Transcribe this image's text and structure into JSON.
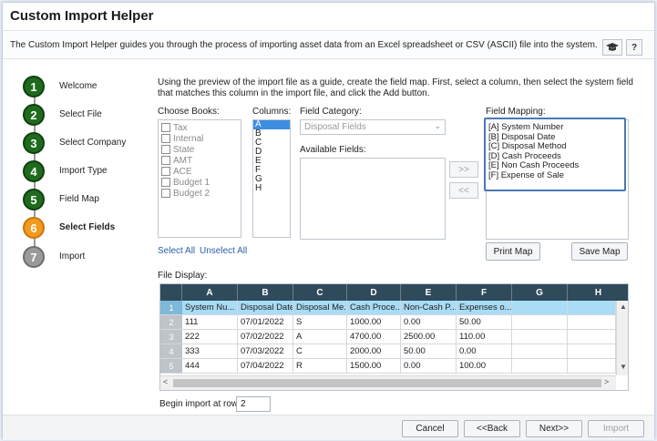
{
  "window": {
    "title": "Custom Import Helper",
    "subtitle": "The Custom Import Helper guides you through the process of importing asset data from an Excel spreadsheet or CSV (ASCII) file into the system.",
    "help_label": "?"
  },
  "steps": [
    {
      "num": "1",
      "label": "Welcome",
      "state": "done"
    },
    {
      "num": "2",
      "label": "Select File",
      "state": "done"
    },
    {
      "num": "3",
      "label": "Select Company",
      "state": "done"
    },
    {
      "num": "4",
      "label": "Import Type",
      "state": "done"
    },
    {
      "num": "5",
      "label": "Field Map",
      "state": "done"
    },
    {
      "num": "6",
      "label": "Select Fields",
      "state": "active"
    },
    {
      "num": "7",
      "label": "Import",
      "state": "pending"
    }
  ],
  "instructions": "Using the preview of the import file as a guide, create the field map.  First, select a column, then select the system field that matches this column in the import file, and click the Add button.",
  "books": {
    "label": "Choose Books:",
    "items": [
      "Tax",
      "Internal",
      "State",
      "AMT",
      "ACE",
      "Budget 1",
      "Budget 2"
    ]
  },
  "columns": {
    "label": "Columns:",
    "items": [
      "A",
      "B",
      "C",
      "D",
      "E",
      "F",
      "G",
      "H"
    ],
    "selected": "A"
  },
  "field_category": {
    "label": "Field Category:",
    "value": "Disposal Fields"
  },
  "available_fields": {
    "label": "Available Fields:"
  },
  "move_buttons": {
    "add": ">>",
    "remove": "<<"
  },
  "field_mapping": {
    "label": "Field Mapping:",
    "items": [
      "[A] System Number",
      "[B] Disposal Date",
      "[C] Disposal Method",
      "[D] Cash Proceeds",
      "[E] Non Cash Proceeds",
      "[F] Expense of Sale"
    ]
  },
  "links": {
    "select_all": "Select All",
    "unselect_all": "Unselect All"
  },
  "map_buttons": {
    "print": "Print Map",
    "save": "Save Map"
  },
  "file_display": {
    "label": "File Display:",
    "columns": [
      "A",
      "B",
      "C",
      "D",
      "E",
      "F",
      "G",
      "H"
    ],
    "rows": [
      {
        "n": "1",
        "cells": [
          "System Nu...",
          "Disposal Date",
          "Disposal Me...",
          "Cash Proce...",
          "Non-Cash P...",
          "Expenses o...",
          "",
          ""
        ]
      },
      {
        "n": "2",
        "cells": [
          "111",
          "07/01/2022",
          "S",
          "1000.00",
          "0.00",
          "50.00",
          "",
          ""
        ]
      },
      {
        "n": "3",
        "cells": [
          "222",
          "07/02/2022",
          "A",
          "4700.00",
          "2500.00",
          "110.00",
          "",
          ""
        ]
      },
      {
        "n": "4",
        "cells": [
          "333",
          "07/03/2022",
          "C",
          "2000.00",
          "50.00",
          "0.00",
          "",
          ""
        ]
      },
      {
        "n": "5",
        "cells": [
          "444",
          "07/04/2022",
          "R",
          "1500.00",
          "0.00",
          "100.00",
          "",
          ""
        ]
      }
    ]
  },
  "begin_import": {
    "label": "Begin import at row:",
    "value": "2"
  },
  "footer": {
    "cancel": "Cancel",
    "back": "<<Back",
    "next": "Next>>",
    "import": "Import"
  }
}
